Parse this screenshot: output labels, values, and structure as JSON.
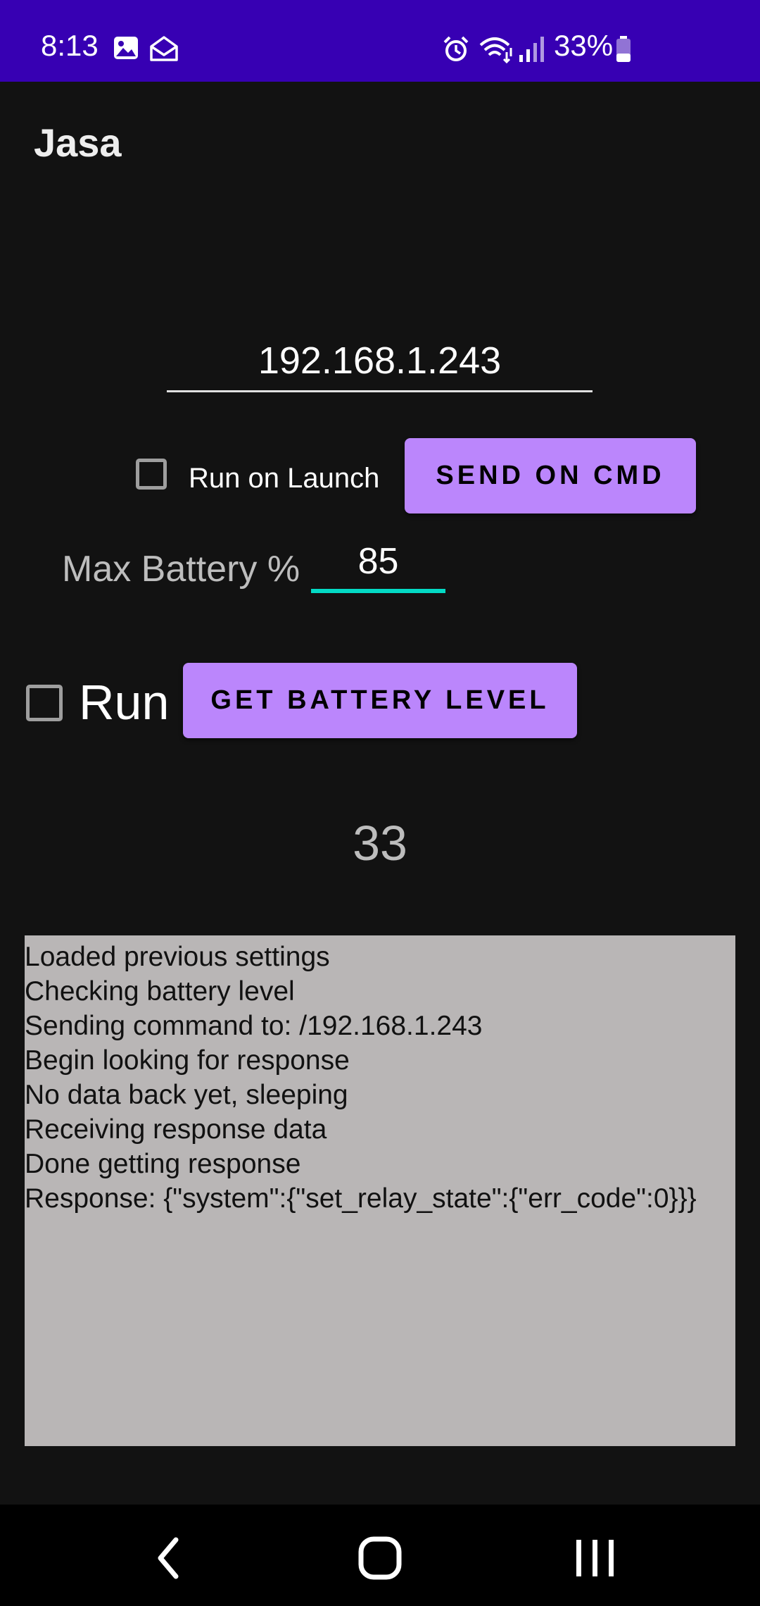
{
  "status_bar": {
    "time": "8:13",
    "battery_percent": "33%",
    "background_color": "#3700b3",
    "icons": [
      "image-icon",
      "mail-icon",
      "alarm-icon",
      "wifi-icon",
      "signal-icon",
      "battery-icon"
    ]
  },
  "app": {
    "title": "Jasa"
  },
  "ip_field": {
    "value": "192.168.1.243"
  },
  "run_on_launch": {
    "label": "Run on Launch",
    "checked": false
  },
  "send_button": {
    "label": "SEND ON CMD"
  },
  "max_battery": {
    "label": "Max Battery %",
    "value": "85"
  },
  "run": {
    "label": "Run",
    "checked": false
  },
  "battery_button": {
    "label": "GET BATTERY LEVEL"
  },
  "battery_level": "33",
  "log": {
    "lines": [
      "Loaded previous settings",
      "Checking battery level",
      "Sending command to: /192.168.1.243",
      "Begin looking for response",
      "No data back yet, sleeping",
      "Receiving response data",
      "Done getting response",
      "Response: {\"system\":{\"set_relay_state\":{\"err_code\":0}}}"
    ]
  },
  "theme": {
    "accent": "#bb86fc",
    "secondary": "#03dac5",
    "background": "#121212"
  },
  "nav_bar": {
    "buttons": [
      "back-icon",
      "home-icon",
      "recents-icon"
    ]
  }
}
